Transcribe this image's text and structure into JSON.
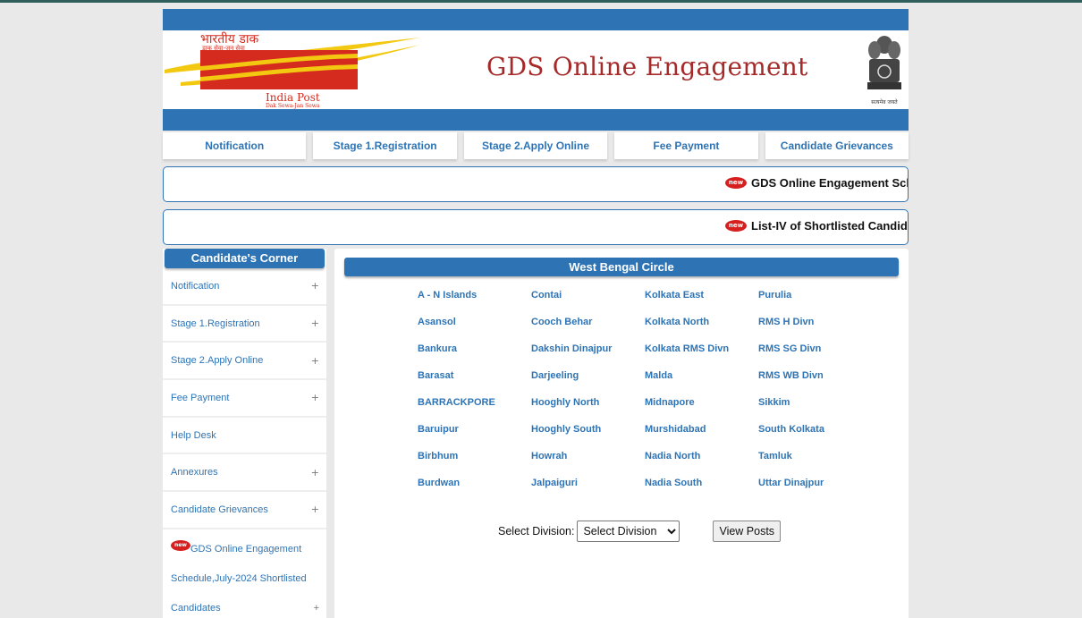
{
  "header": {
    "logo_hindi": "भारतीय डाक",
    "logo_hindi_tagline": "डाक सेवा-जन सेवा",
    "logo_english": "India Post",
    "logo_english_tagline": "Dak Sewa-Jan Sewa",
    "title": "GDS Online Engagement",
    "emblem_caption": "सत्यमेव जयते"
  },
  "nav": {
    "items": [
      "Notification",
      "Stage 1.Registration",
      "Stage 2.Apply Online",
      "Fee Payment",
      "Candidate Grievances"
    ]
  },
  "marquees": [
    {
      "badge": "new",
      "text": "GDS Online Engagement Sch"
    },
    {
      "badge": "new",
      "text": "List-IV of Shortlisted Candida"
    }
  ],
  "sidebar": {
    "title": "Candidate's Corner",
    "items": [
      {
        "label": "Notification",
        "plus": "+"
      },
      {
        "label": "Stage 1.Registration",
        "plus": "+"
      },
      {
        "label": "Stage 2.Apply Online",
        "plus": "+"
      },
      {
        "label": "Fee Payment",
        "plus": "+"
      },
      {
        "label": "Help Desk",
        "plus": ""
      },
      {
        "label": "Annexures",
        "plus": "+"
      },
      {
        "label": "Candidate Grievances",
        "plus": "+"
      }
    ],
    "news": {
      "badge": "new",
      "line1": "GDS Online Engagement",
      "line2": "Schedule,July-2024 Shortlisted",
      "line3": "Candidates",
      "plus": "+"
    }
  },
  "main": {
    "circle_title": "West Bengal Circle",
    "divisions": [
      "A - N Islands",
      "Contai",
      "Kolkata East",
      "Purulia",
      "Asansol",
      "Cooch Behar",
      "Kolkata North",
      "RMS H Divn",
      "Bankura",
      "Dakshin Dinajpur",
      "Kolkata RMS Divn",
      "RMS SG Divn",
      "Barasat",
      "Darjeeling",
      "Malda",
      "RMS WB Divn",
      "BARRACKPORE",
      "Hooghly North",
      "Midnapore",
      "Sikkim",
      "Baruipur",
      "Hooghly South",
      "Murshidabad",
      "South Kolkata",
      "Birbhum",
      "Howrah",
      "Nadia North",
      "Tamluk",
      "Burdwan",
      "Jalpaiguri",
      "Nadia South",
      "Uttar Dinajpur"
    ],
    "select_label": "Select Division:",
    "select_value": "Select Division",
    "view_button": "View Posts"
  },
  "colors": {
    "brand_blue": "#2e74b5",
    "title_red": "#a52a2a",
    "logo_red": "#d52b1e",
    "logo_yellow": "#f2c811"
  }
}
